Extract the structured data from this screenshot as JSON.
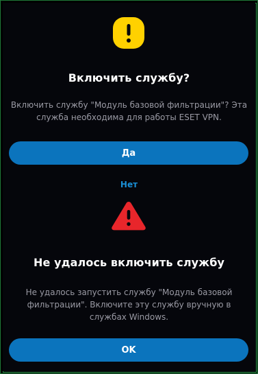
{
  "dialog_confirm": {
    "icon": "warning-exclamation-icon",
    "icon_color": "#FFD100",
    "title": "Включить службу?",
    "description": "Включить службу \"Модуль базовой фильтрации\"? Эта служба необходима для работы ESET VPN.",
    "yes_label": "Да",
    "no_label": "Нет"
  },
  "dialog_error": {
    "icon": "error-triangle-icon",
    "icon_color": "#E8262B",
    "title": "Не удалось включить службу",
    "description": "Не удалось запустить службу \"Модуль базовой фильтрации\". Включите эту службу вручную в службах Windows.",
    "ok_label": "OK"
  },
  "colors": {
    "accent": "#0B74BD",
    "link": "#1A8FD6",
    "background": "#05060B",
    "border": "#2A9A4A"
  }
}
